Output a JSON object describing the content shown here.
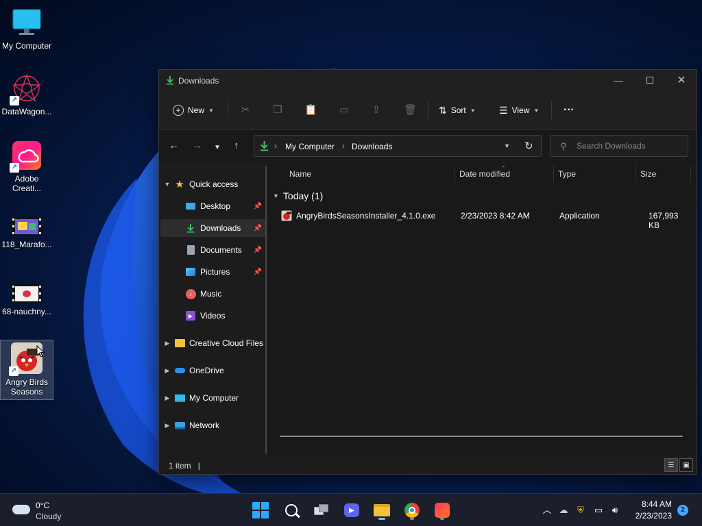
{
  "desktop": {
    "icons": [
      {
        "label": "My Computer"
      },
      {
        "label": "DataWagon..."
      },
      {
        "label": "Adobe Creati..."
      },
      {
        "label": "118_Marafo..."
      },
      {
        "label": "68-nauchny..."
      },
      {
        "label": "Angry Birds Seasons"
      }
    ]
  },
  "window": {
    "title": "Downloads",
    "toolbar": {
      "new_label": "New",
      "sort_label": "Sort",
      "view_label": "View",
      "more_label": "···"
    },
    "address": {
      "crumbs": [
        "My Computer",
        "Downloads"
      ]
    },
    "search": {
      "placeholder": "Search Downloads"
    },
    "sidebar": {
      "quick_access": "Quick access",
      "items": [
        {
          "label": "Desktop"
        },
        {
          "label": "Downloads"
        },
        {
          "label": "Documents"
        },
        {
          "label": "Pictures"
        },
        {
          "label": "Music"
        },
        {
          "label": "Videos"
        }
      ],
      "sections": [
        {
          "label": "Creative Cloud Files"
        },
        {
          "label": "OneDrive"
        },
        {
          "label": "My Computer"
        },
        {
          "label": "Network"
        }
      ]
    },
    "columns": {
      "name": "Name",
      "date": "Date modified",
      "type": "Type",
      "size": "Size"
    },
    "group": {
      "label": "Today (1)"
    },
    "files": [
      {
        "name": "AngryBirdsSeasonsInstaller_4.1.0.exe",
        "date": "2/23/2023 8:42 AM",
        "type": "Application",
        "size": "167,993 KB"
      }
    ],
    "status": {
      "text": "1 item"
    }
  },
  "taskbar": {
    "weather": {
      "temp": "0°C",
      "condition": "Cloudy"
    },
    "clock": {
      "time": "8:44 AM",
      "date": "2/23/2023"
    },
    "notifications": "2"
  },
  "colors": {
    "accent": "#0a6cff",
    "download_green": "#3cc46a",
    "folder_yellow": "#f2c23a"
  }
}
